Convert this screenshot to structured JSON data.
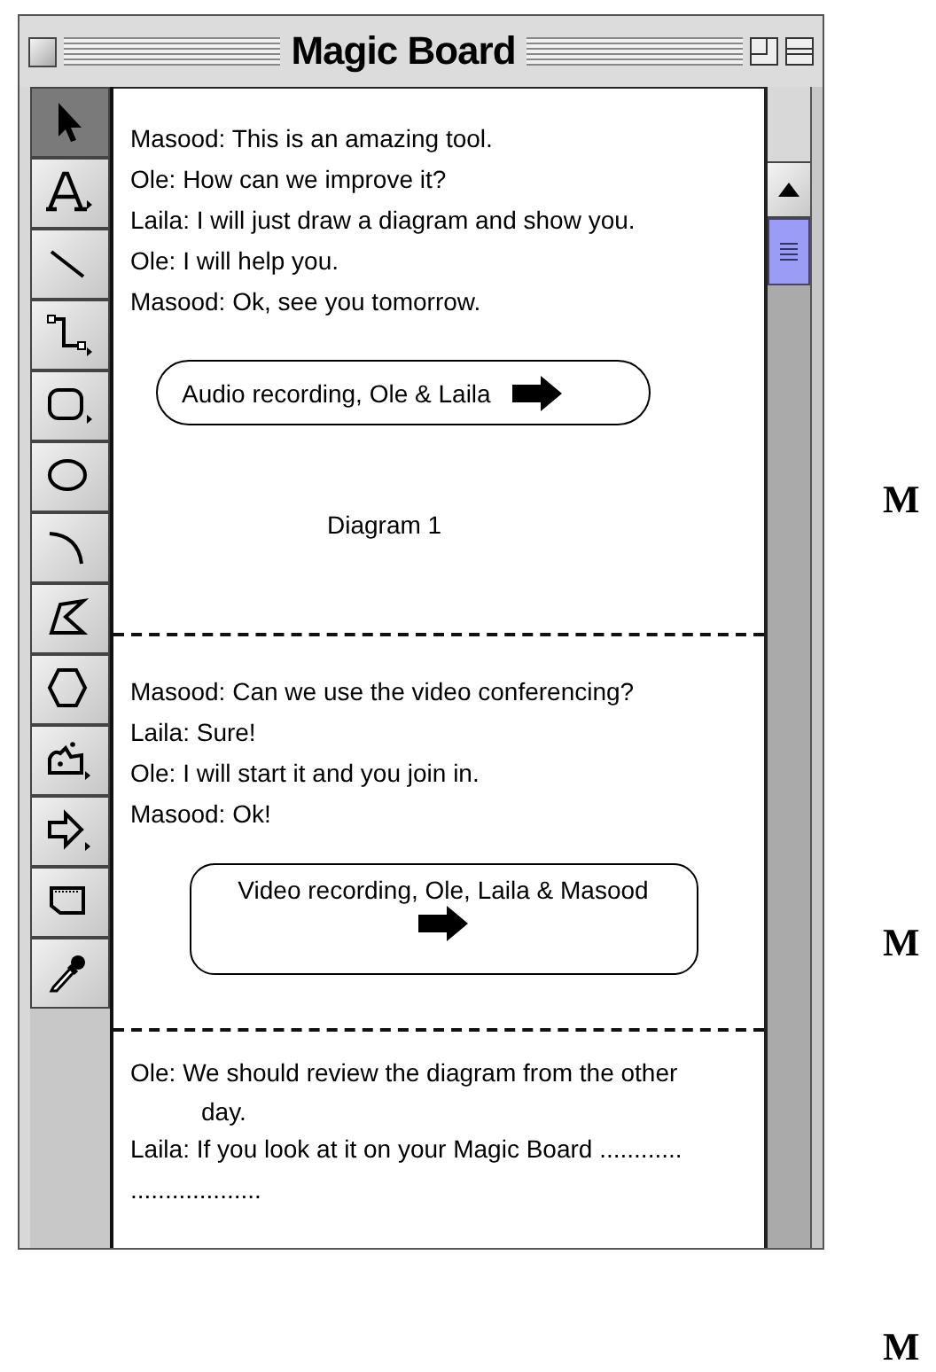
{
  "window": {
    "title": "Magic Board"
  },
  "tools": [
    {
      "kind": "pointer",
      "selected": true
    },
    {
      "kind": "text",
      "selected": false
    },
    {
      "kind": "line",
      "selected": false
    },
    {
      "kind": "connector",
      "selected": false
    },
    {
      "kind": "roundrect",
      "selected": false
    },
    {
      "kind": "ellipse",
      "selected": false
    },
    {
      "kind": "arc",
      "selected": false
    },
    {
      "kind": "polygon",
      "selected": false
    },
    {
      "kind": "hexagon",
      "selected": false
    },
    {
      "kind": "freeform",
      "selected": false
    },
    {
      "kind": "arrow",
      "selected": false
    },
    {
      "kind": "note",
      "selected": false
    },
    {
      "kind": "eyedropper",
      "selected": false
    }
  ],
  "sections": [
    {
      "lines": [
        {
          "text": "Masood: This is an amazing tool.",
          "indented": false
        },
        {
          "text": "Ole: How can we improve it?",
          "indented": false
        },
        {
          "text": "Laila: I will just draw a diagram and show you.",
          "indented": false
        },
        {
          "text": "Ole: I will help you.",
          "indented": false
        },
        {
          "text": "Masood: Ok, see you tomorrow.",
          "indented": false
        }
      ],
      "recording": {
        "kind": "pill",
        "label": "Audio recording, Ole & Laila"
      },
      "caption": "Diagram 1"
    },
    {
      "lines": [
        {
          "text": "Masood: Can we use the video conferencing?",
          "indented": false
        },
        {
          "text": "Laila: Sure!",
          "indented": false
        },
        {
          "text": "Ole: I will start it and you join in.",
          "indented": false
        },
        {
          "text": "Masood: Ok!",
          "indented": false
        }
      ],
      "recording": {
        "kind": "box",
        "label": "Video recording, Ole, Laila & Masood"
      }
    },
    {
      "lines": [
        {
          "text": "Ole: We should review the diagram from the other",
          "indented": false
        },
        {
          "text": "day.",
          "indented": true
        },
        {
          "text": "Laila: If you look at it on your Magic Board ............",
          "indented": false
        },
        {
          "text": "...................",
          "indented": false
        }
      ]
    }
  ],
  "margin_marks": [
    "M",
    "M",
    "M"
  ]
}
